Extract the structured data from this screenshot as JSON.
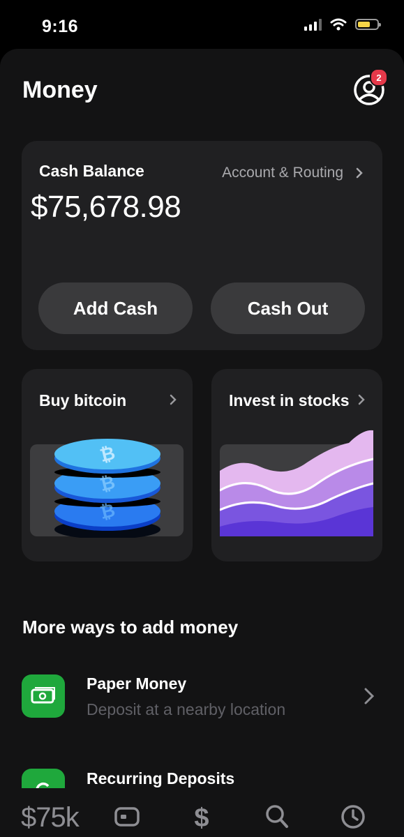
{
  "status_bar": {
    "time": "9:16"
  },
  "header": {
    "title": "Money",
    "notification_count": "2"
  },
  "balance_card": {
    "label": "Cash Balance",
    "amount": "$75,678.98",
    "account_link": "Account & Routing",
    "add_cash": "Add Cash",
    "cash_out": "Cash Out"
  },
  "tiles": [
    {
      "title": "Buy bitcoin",
      "icon": "bitcoin-coins"
    },
    {
      "title": "Invest in stocks",
      "icon": "stock-waves"
    }
  ],
  "more_ways": {
    "title": "More ways to add money",
    "items": [
      {
        "title": "Paper Money",
        "subtitle": "Deposit at a nearby location",
        "icon": "cash-icon"
      },
      {
        "title": "Recurring Deposits",
        "subtitle": "",
        "icon": "refresh-icon"
      }
    ]
  },
  "tab_bar": {
    "balance_label": "$75k",
    "tabs": [
      "card-icon",
      "dollar-icon",
      "search-icon",
      "clock-icon"
    ]
  },
  "colors": {
    "accent_green": "#1fa83c",
    "badge_red": "#e5394a",
    "battery_yellow": "#f7d648",
    "card_bg": "#202022",
    "pill_bg": "#3a3a3c"
  }
}
